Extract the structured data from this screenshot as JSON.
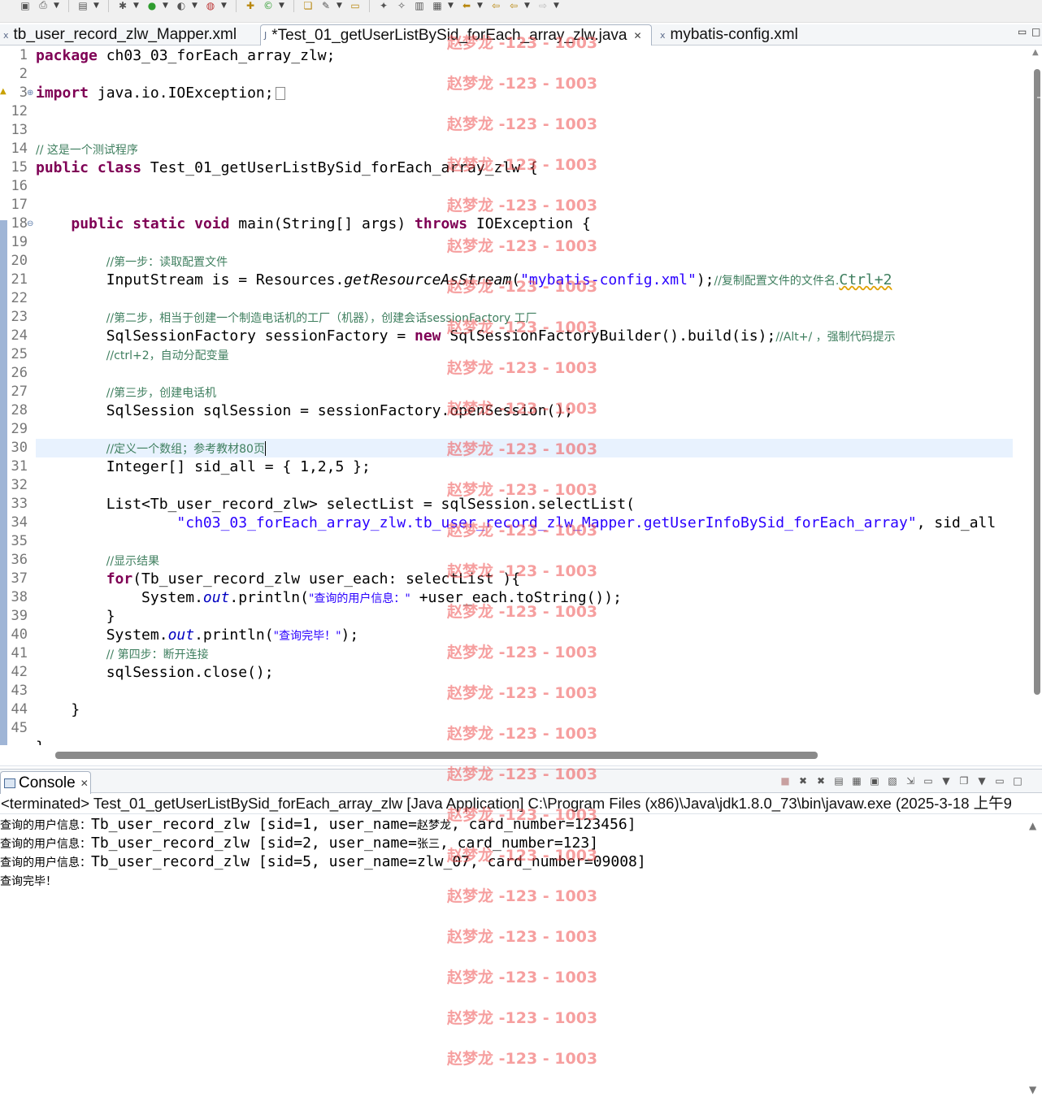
{
  "toolbar": {
    "icons": [
      "save-icon",
      "print-icon",
      "debug-icon",
      "run-icon",
      "coverage-icon",
      "external-tools-icon",
      "new-java-project-icon",
      "new-package-icon",
      "new-class-icon",
      "open-type-icon",
      "search-icon",
      "next-annotation-icon",
      "prev-annotation-icon",
      "last-edit-icon",
      "back-icon",
      "forward-icon"
    ]
  },
  "editor_tabs": [
    {
      "label": "tb_user_record_zlw_Mapper.xml",
      "icon": "xml-file-icon",
      "active": false
    },
    {
      "label": "*Test_01_getUserListBySid_forEach_array_zlw.java",
      "icon": "java-file-icon",
      "active": true
    },
    {
      "label": "mybatis-config.xml",
      "icon": "xml-file-icon",
      "active": false
    }
  ],
  "editor": {
    "line_numbers": [
      "1",
      "2",
      "3",
      "12",
      "13",
      "14",
      "15",
      "16",
      "17",
      "18",
      "19",
      "20",
      "21",
      "22",
      "23",
      "24",
      "25",
      "26",
      "27",
      "28",
      "29",
      "30",
      "31",
      "32",
      "33",
      "34",
      "35",
      "36",
      "37",
      "38",
      "39",
      "40",
      "41",
      "42",
      "43",
      "44",
      "45"
    ],
    "code": {
      "l1_kw": "package",
      "l1_rest": " ch03_03_forEach_array_zlw;",
      "l3_kw": "import",
      "l3_rest": " java.io.IOException;",
      "l14_comment": "// 这是一个测试程序",
      "l15_kw1": "public",
      "l15_kw2": "class",
      "l15_rest": " Test_01_getUserListBySid_forEach_array_zlw {",
      "l18_kw1": "public",
      "l18_kw2": "static",
      "l18_kw3": "void",
      "l18_mid": " main(String[] args) ",
      "l18_kw4": "throws",
      "l18_rest": " IOException {",
      "l20_comment": "//第一步：读取配置文件",
      "l21_pre": "InputStream is = Resources.",
      "l21_method": "getResourceAsStream",
      "l21_open": "(",
      "l21_str": "\"mybatis-config.xml\"",
      "l21_close": ");",
      "l21_comment": "//复制配置文件的文件名.",
      "l21_comment2": "Ctrl+2",
      "l23_comment": "//第二步，相当于创建一个制造电话机的工厂（机器），创建会话sessionFactory 工厂",
      "l24_pre": "SqlSessionFactory sessionFactory = ",
      "l24_kw": "new",
      "l24_rest": " SqlSessionFactoryBuilder().build(is);",
      "l24_comment": "//Alt+/ ，强制代码提示",
      "l25_comment": "//ctrl+2，自动分配变量",
      "l27_comment": "//第三步，创建电话机",
      "l28": "SqlSession sqlSession = sessionFactory.openSession();",
      "l30_comment": "//定义一个数组；参考教材80页",
      "l31": "Integer[] sid_all = { 1,2,5 };",
      "l33": "List<Tb_user_record_zlw> selectList = sqlSession.selectList(",
      "l34_str": "\"ch03_03_forEach_array_zlw.tb_user_record_zlw_Mapper.getUserInfoBySid_forEach_array\"",
      "l34_rest": ", sid_all",
      "l36_comment": "//显示结果",
      "l37_kw": "for",
      "l37_rest": "(Tb_user_record_zlw user_each: selectList ){",
      "l38_pre": "System.",
      "l38_out": "out",
      "l38_mid": ".println(",
      "l38_str": "\"查询的用户信息：\"",
      "l38_rest": " +user_each.toString());",
      "l39": "}",
      "l40_pre": "System.",
      "l40_out": "out",
      "l40_mid": ".println(",
      "l40_str": "\"查询完毕！\"",
      "l40_rest": ");",
      "l41_comment": "// 第四步：断开连接",
      "l42": "sqlSession.close();",
      "l44": "}",
      "l46": "}"
    }
  },
  "console": {
    "tab_label": "Console",
    "header": "<terminated> Test_01_getUserListBySid_forEach_array_zlw [Java Application] C:\\Program Files (x86)\\Java\\jdk1.8.0_73\\bin\\javaw.exe (2025-3-18 上午9",
    "lines": [
      {
        "prefix": "查询的用户信息：",
        "body": "Tb_user_record_zlw [sid=1, user_name=",
        "name": "赵梦龙",
        "tail": ", card_number=123456]"
      },
      {
        "prefix": "查询的用户信息：",
        "body": "Tb_user_record_zlw [sid=2, user_name=",
        "name": "张三",
        "tail": ", card_number=123]"
      },
      {
        "prefix": "查询的用户信息：",
        "body": "Tb_user_record_zlw [sid=5, user_name=zlw_07, card_number=09008]",
        "name": "",
        "tail": ""
      },
      {
        "prefix": "查询完毕！",
        "body": "",
        "name": "",
        "tail": ""
      }
    ]
  },
  "watermark": {
    "text": "赵梦龙 -123 - 1003",
    "color": "#ee5050"
  },
  "colors": {
    "keyword": "#7f0055",
    "comment": "#3f7f5f",
    "string": "#2a00ff",
    "static_field": "#0000c0",
    "current_line": "#e8f2fe",
    "change_bar": "#9fb5d6"
  }
}
